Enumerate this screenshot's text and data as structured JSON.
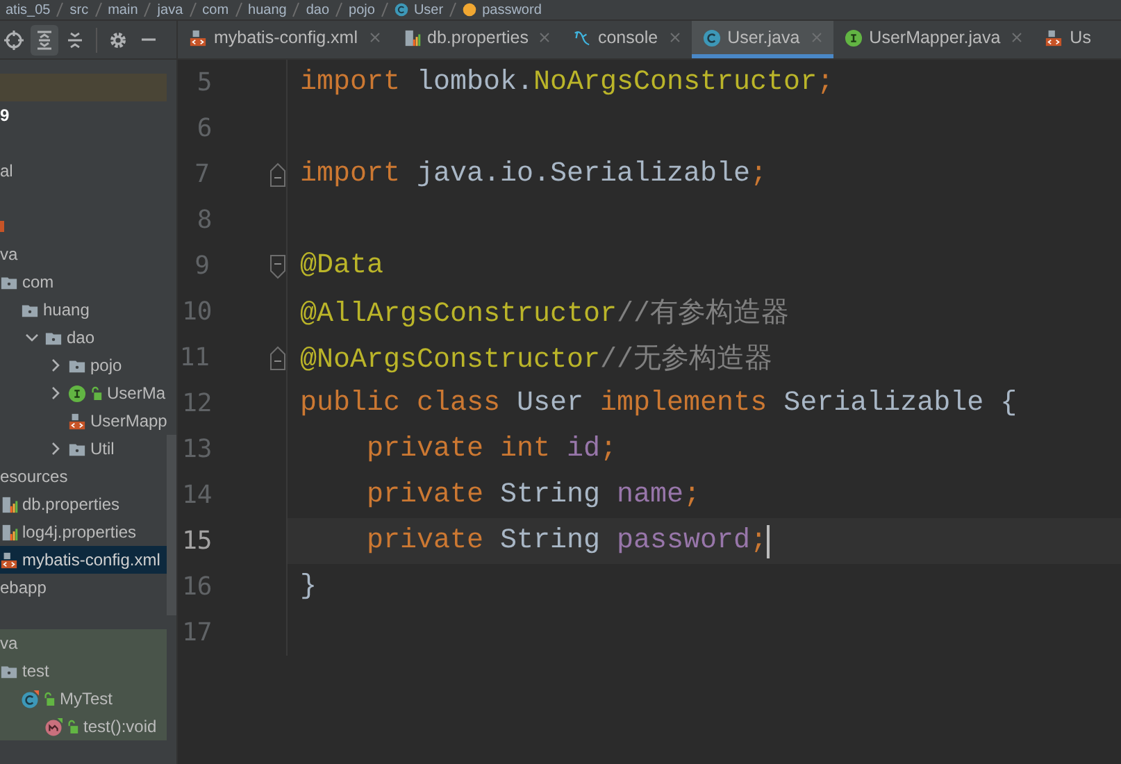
{
  "breadcrumb": [
    {
      "label": "atis_05",
      "kind": "folder"
    },
    {
      "label": "src",
      "kind": "folder"
    },
    {
      "label": "main",
      "kind": "folder"
    },
    {
      "label": "java",
      "kind": "folder"
    },
    {
      "label": "com",
      "kind": "folder"
    },
    {
      "label": "huang",
      "kind": "folder"
    },
    {
      "label": "dao",
      "kind": "folder"
    },
    {
      "label": "pojo",
      "kind": "folder"
    },
    {
      "label": "User",
      "kind": "class"
    },
    {
      "label": "password",
      "kind": "field"
    }
  ],
  "toolbar": [
    {
      "kind": "locate",
      "selected": false
    },
    {
      "kind": "expand",
      "selected": true
    },
    {
      "kind": "collapse",
      "selected": false
    },
    {
      "kind": "gear",
      "selected": false
    },
    {
      "kind": "minimize",
      "selected": false
    }
  ],
  "tabs": [
    {
      "label": "mybatis-config.xml",
      "kind": "xml",
      "selected": false,
      "closable": true
    },
    {
      "label": "db.properties",
      "kind": "properties",
      "selected": false,
      "closable": true
    },
    {
      "label": "console",
      "kind": "console",
      "selected": false,
      "closable": true
    },
    {
      "label": "User.java",
      "kind": "class",
      "selected": true,
      "closable": true
    },
    {
      "label": "UserMapper.java",
      "kind": "interface",
      "selected": false,
      "closable": true
    },
    {
      "label": "Us",
      "kind": "xml",
      "selected": false,
      "closable": false
    }
  ],
  "tree": [
    {
      "kind": "highlight"
    },
    {
      "kind": "bold-label",
      "label": "9",
      "selected": false
    },
    {
      "kind": "spacer"
    },
    {
      "kind": "label",
      "label": "al",
      "selected": false
    },
    {
      "kind": "spacer"
    },
    {
      "kind": "mark"
    },
    {
      "kind": "label",
      "label": "va",
      "selected": false,
      "children": [
        {
          "kind": "package",
          "label": "com",
          "selected": false,
          "children": [
            {
              "kind": "package",
              "label": "huang",
              "selected": false,
              "children": [
                {
                  "kind": "package",
                  "label": "dao",
                  "selected": false,
                  "expanded": true,
                  "children": [
                    {
                      "kind": "package",
                      "label": "pojo",
                      "selected": false,
                      "expanded": false
                    },
                    {
                      "kind": "interface",
                      "label": "UserMa",
                      "selected": false,
                      "locked": true,
                      "expanded": false
                    },
                    {
                      "kind": "xml",
                      "label": "UserMapp",
                      "selected": false
                    },
                    {
                      "kind": "package",
                      "label": "Util",
                      "selected": false,
                      "expanded": false
                    }
                  ]
                }
              ]
            }
          ]
        }
      ]
    },
    {
      "kind": "label",
      "label": "esources",
      "selected": false,
      "children": [
        {
          "kind": "properties",
          "label": "db.properties",
          "selected": false
        },
        {
          "kind": "properties",
          "label": "log4j.properties",
          "selected": false
        },
        {
          "kind": "xml",
          "label": "mybatis-config.xml",
          "selected": true
        }
      ]
    },
    {
      "kind": "label",
      "label": "ebapp",
      "selected": false
    },
    {
      "kind": "spacer"
    },
    {
      "kind": "label",
      "label": "va",
      "selected": false,
      "test_source": true,
      "children": [
        {
          "kind": "package",
          "label": "test",
          "selected": false,
          "children": [
            {
              "kind": "testclass",
              "label": "MyTest",
              "selected": false,
              "locked": true,
              "children": [
                {
                  "kind": "method",
                  "label": "test():void",
                  "selected": false,
                  "locked": true
                }
              ]
            }
          ]
        }
      ]
    }
  ],
  "code": [
    {
      "number": "5",
      "current": false,
      "kind": "plain",
      "tokens": [
        {
          "kind": "keyword",
          "text": "import "
        },
        {
          "kind": "plain",
          "text": "lombok."
        },
        {
          "kind": "annotation",
          "text": "NoArgsConstructor"
        },
        {
          "kind": "keyword",
          "text": ";"
        }
      ]
    },
    {
      "number": "6",
      "current": false,
      "kind": "plain"
    },
    {
      "number": "7",
      "current": false,
      "kind": "fold-end",
      "tokens": [
        {
          "kind": "keyword",
          "text": "import "
        },
        {
          "kind": "plain",
          "text": "java.io.Serializable"
        },
        {
          "kind": "keyword",
          "text": ";"
        }
      ]
    },
    {
      "number": "8",
      "current": false,
      "kind": "plain"
    },
    {
      "number": "9",
      "current": false,
      "kind": "fold-start",
      "tokens": [
        {
          "kind": "annotation",
          "text": "@Data"
        }
      ]
    },
    {
      "number": "10",
      "current": false,
      "kind": "plain",
      "tokens": [
        {
          "kind": "annotation",
          "text": "@AllArgsConstructor"
        },
        {
          "kind": "comment",
          "text": "//有参构造器"
        }
      ]
    },
    {
      "number": "11",
      "current": false,
      "kind": "fold-end",
      "tokens": [
        {
          "kind": "annotation",
          "text": "@NoArgsConstructor"
        },
        {
          "kind": "comment",
          "text": "//无参构造器"
        }
      ]
    },
    {
      "number": "12",
      "current": false,
      "kind": "plain",
      "tokens": [
        {
          "kind": "keyword",
          "text": "public class "
        },
        {
          "kind": "plain",
          "text": "User "
        },
        {
          "kind": "keyword",
          "text": "implements "
        },
        {
          "kind": "plain",
          "text": "Serializable {"
        }
      ]
    },
    {
      "number": "13",
      "current": false,
      "kind": "plain",
      "tokens": [
        {
          "kind": "keyword",
          "text": "    private int "
        },
        {
          "kind": "field",
          "text": "id"
        },
        {
          "kind": "keyword",
          "text": ";"
        }
      ]
    },
    {
      "number": "14",
      "current": false,
      "kind": "plain",
      "tokens": [
        {
          "kind": "keyword",
          "text": "    private "
        },
        {
          "kind": "plain",
          "text": "String "
        },
        {
          "kind": "field",
          "text": "name"
        },
        {
          "kind": "keyword",
          "text": ";"
        }
      ]
    },
    {
      "number": "15",
      "current": true,
      "kind": "plain",
      "tokens": [
        {
          "kind": "keyword",
          "text": "    private "
        },
        {
          "kind": "plain",
          "text": "String "
        },
        {
          "kind": "field",
          "text": "password"
        },
        {
          "kind": "keyword",
          "text": ";"
        }
      ]
    },
    {
      "number": "16",
      "current": false,
      "kind": "plain",
      "tokens": [
        {
          "kind": "plain",
          "text": "}"
        }
      ]
    },
    {
      "number": "17",
      "current": false,
      "kind": "plain"
    }
  ]
}
